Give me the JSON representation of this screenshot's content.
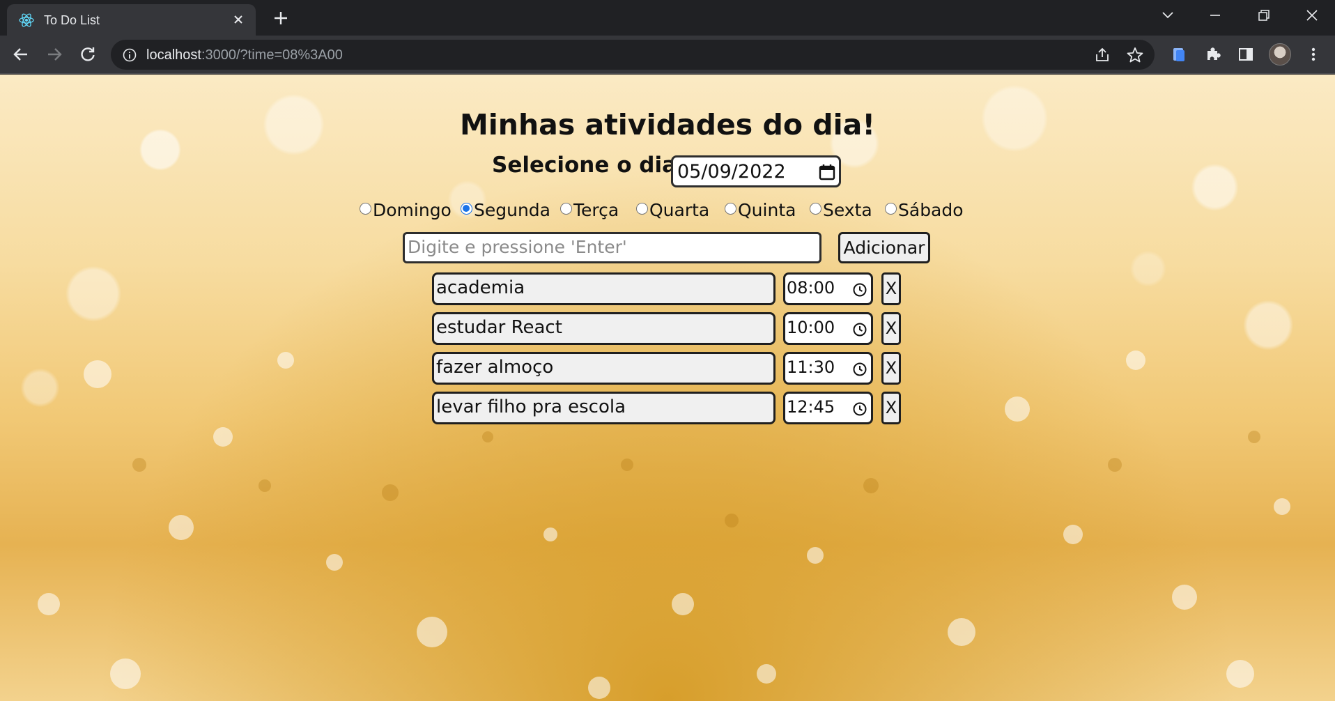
{
  "browser": {
    "tab_title": "To Do List",
    "url_host": "localhost",
    "url_rest": ":3000/?time=08%3A00",
    "favicon": "react-logo-icon"
  },
  "page": {
    "title": "Minhas atividades do dia!",
    "day_label": "Selecione o dia:",
    "date_value": "05/09/2022",
    "weekdays": [
      {
        "label": "Domingo",
        "checked": false
      },
      {
        "label": "Segunda",
        "checked": true
      },
      {
        "label": "Terça",
        "checked": false
      },
      {
        "label": "Quarta",
        "checked": false
      },
      {
        "label": "Quinta",
        "checked": false
      },
      {
        "label": "Sexta",
        "checked": false
      },
      {
        "label": "Sábado",
        "checked": false
      }
    ],
    "input_placeholder": "Digite e pressione 'Enter'",
    "add_button": "Adicionar",
    "tasks": [
      {
        "text": "academia",
        "time": "08:00",
        "delete": "X"
      },
      {
        "text": "estudar React",
        "time": "10:00",
        "delete": "X"
      },
      {
        "text": "fazer almoço",
        "time": "11:30",
        "delete": "X"
      },
      {
        "text": "levar filho pra escola",
        "time": "12:45",
        "delete": "X"
      }
    ]
  },
  "colors": {
    "chrome_dark": "#202124",
    "chrome_toolbar": "#35363a",
    "radio_accent": "#1a73e8",
    "background_gold": "#f1c875"
  }
}
